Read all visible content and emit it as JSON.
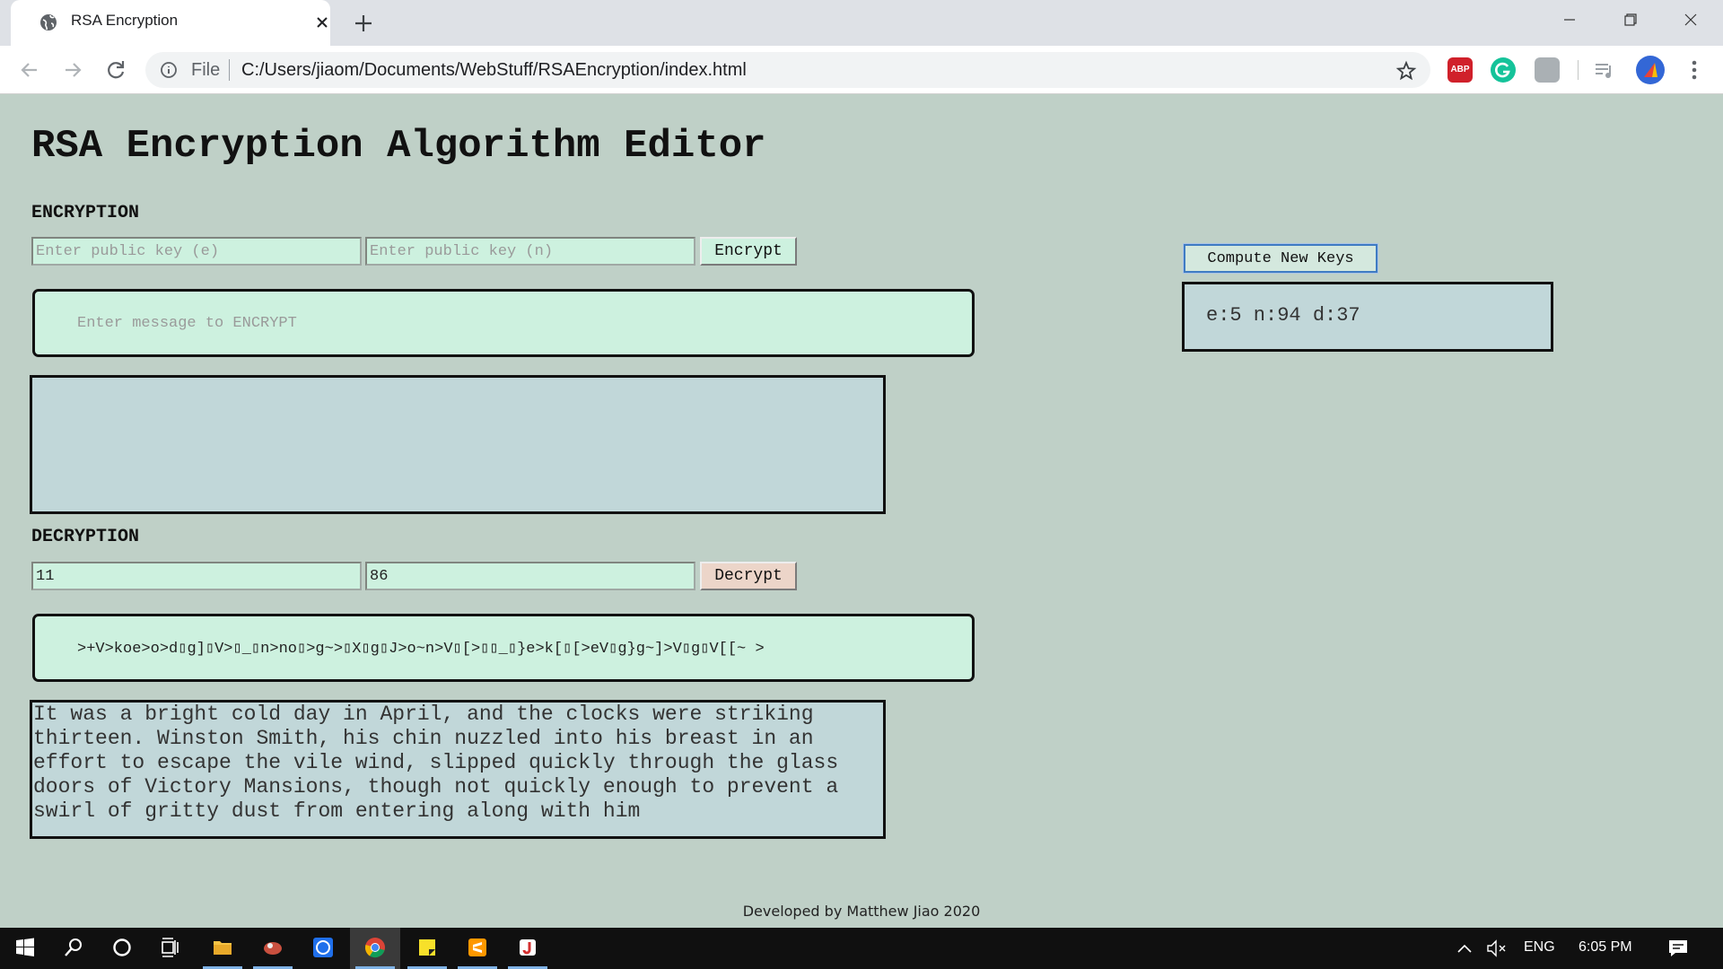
{
  "browser": {
    "tab_title": "RSA Encryption",
    "scheme_label": "File",
    "url": "C:/Users/jiaom/Documents/WebStuff/RSAEncryption/index.html",
    "extensions": {
      "abp_label": "ABP"
    }
  },
  "page": {
    "title": "RSA Encryption Algorithm Editor",
    "encryption": {
      "label": "ENCRYPTION",
      "e_placeholder": "Enter public key (e)",
      "n_placeholder": "Enter public key (n)",
      "button_label": "Encrypt",
      "message_placeholder": "Enter message to ENCRYPT",
      "output": ""
    },
    "decryption": {
      "label": "DECRYPTION",
      "e_value": "11",
      "n_value": "86",
      "button_label": "Decrypt",
      "message_value": ">+V>koe>o>d▯g]▯V>▯_▯n>no▯>g~>▯X▯g▯J>o~n>V▯[>▯▯_▯}e>k[▯[>eV▯g}g~]>V▯g▯V[[~ >",
      "output": "It was a bright cold day in April, and the clocks were striking thirteen. Winston Smith, his chin nuzzled into his breast in an effort to escape the vile wind, slipped quickly through the glass doors of Victory Mansions, though not quickly enough to prevent a swirl of gritty dust from entering along with him"
    },
    "keys": {
      "button_label": "Compute New Keys",
      "display": "e:5 n:94 d:37"
    },
    "footer": "Developed by Matthew Jiao 2020"
  },
  "taskbar": {
    "language": "ENG",
    "clock": "6:05 PM"
  },
  "colors": {
    "page_bg": "#bfd0c7",
    "input_bg": "#cdf1df",
    "output_bg": "#c1d7d9",
    "decrypt_btn_bg": "#ecd5c9"
  },
  "icons": [
    "globe-icon",
    "close-icon",
    "plus-icon",
    "minimize-icon",
    "maximize-icon",
    "back-icon",
    "forward-icon",
    "reload-icon",
    "info-icon",
    "star-icon",
    "media-icon",
    "menu-icon",
    "windows-start-icon",
    "search-icon",
    "cortana-icon",
    "task-view-icon"
  ]
}
